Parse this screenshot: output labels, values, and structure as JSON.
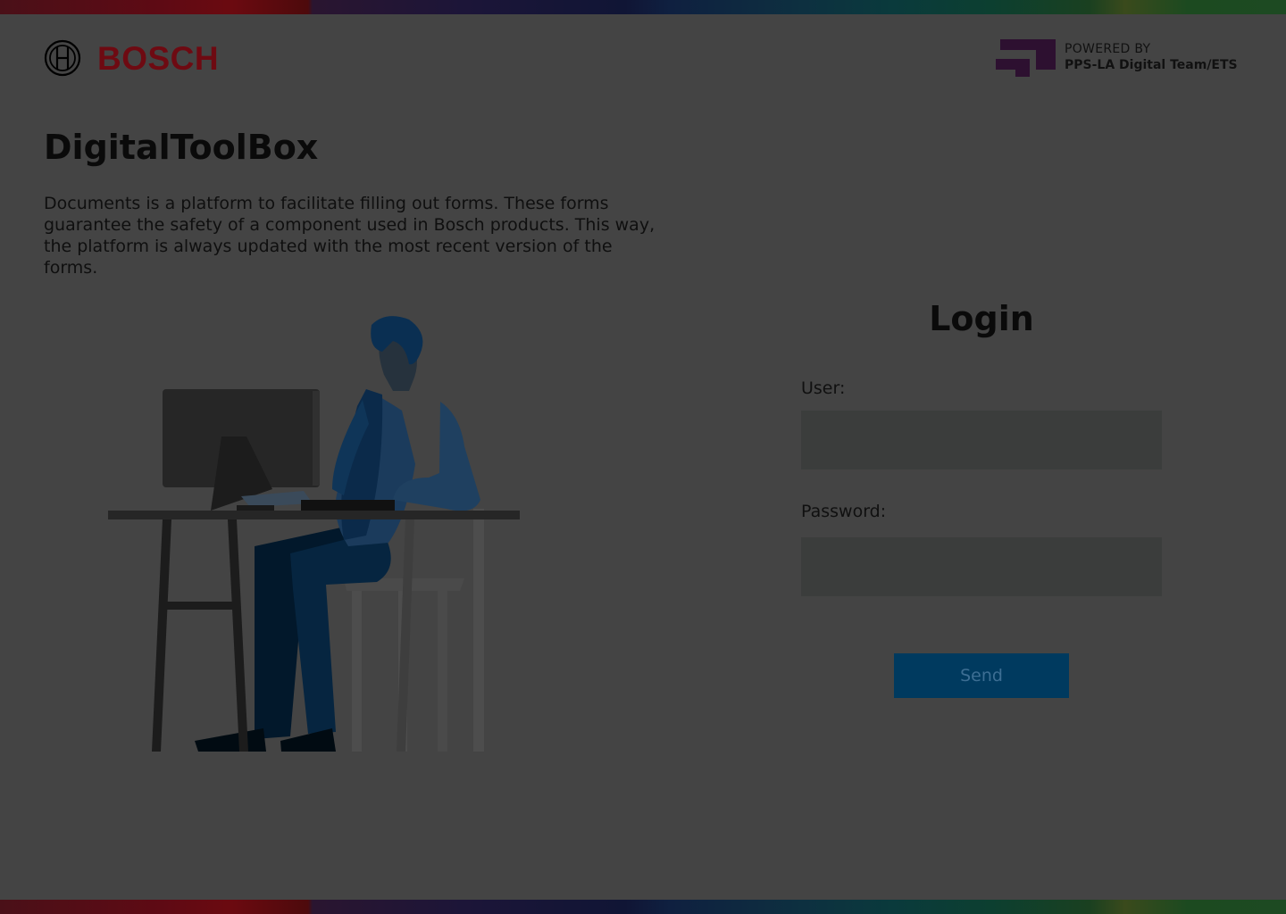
{
  "header": {
    "brand": "BOSCH",
    "powered_by_label": "POWERED BY",
    "powered_by_team": "PPS-LA Digital Team/ETS"
  },
  "intro": {
    "title": "DigitalToolBox",
    "description": "Documents is a platform to facilitate filling out forms. These forms guarantee the safety of a component used in Bosch products. This way, the platform is always updated with the most recent version of the forms."
  },
  "login": {
    "title": "Login",
    "user_label": "User:",
    "user_value": "",
    "password_label": "Password:",
    "password_value": "",
    "send_label": "Send"
  },
  "colors": {
    "overlay_background": "#444444",
    "brand_red": "#6e0a12",
    "input_background": "#3b3d3c",
    "button_background": "#003a5f",
    "button_text": "#3d6e93"
  }
}
